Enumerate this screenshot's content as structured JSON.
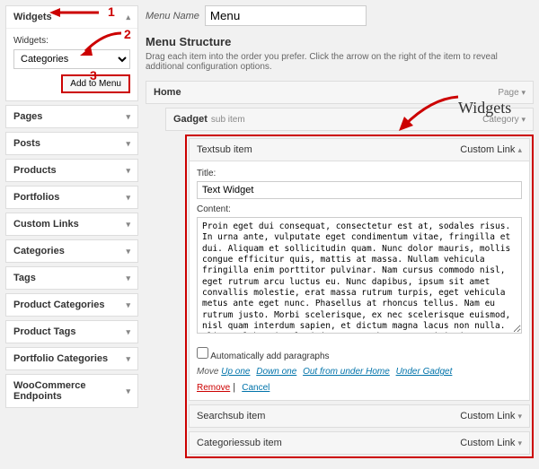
{
  "sidebar": {
    "widgets_title": "Widgets",
    "widgets_label": "Widgets:",
    "widgets_select": "Categories",
    "add_btn": "Add to Menu",
    "sections": [
      {
        "label": "Pages"
      },
      {
        "label": "Posts"
      },
      {
        "label": "Products"
      },
      {
        "label": "Portfolios"
      },
      {
        "label": "Custom Links"
      },
      {
        "label": "Categories"
      },
      {
        "label": "Tags"
      },
      {
        "label": "Product Categories"
      },
      {
        "label": "Product Tags"
      },
      {
        "label": "Portfolio Categories"
      },
      {
        "label": "WooCommerce Endpoints"
      }
    ]
  },
  "main": {
    "menu_name_label": "Menu Name",
    "menu_name_value": "Menu",
    "structure_title": "Menu Structure",
    "structure_desc": "Drag each item into the order you prefer. Click the arrow on the right of the item to reveal additional configuration options.",
    "items": {
      "home": {
        "name": "Home",
        "type": "Page"
      },
      "gadget": {
        "name": "Gadget",
        "sub": "sub item",
        "type": "Category"
      },
      "text": {
        "name": "Text",
        "sub": "sub item",
        "type": "Custom Link",
        "title_label": "Title:",
        "title_value": "Text Widget",
        "content_label": "Content:",
        "content_value": "Proin eget dui consequat, consectetur est at, sodales risus. In urna ante, vulputate eget condimentum vitae, fringilla et dui. Aliquam et sollicitudin quam. Nunc dolor mauris, mollis congue efficitur quis, mattis at massa. Nullam vehicula fringilla enim porttitor pulvinar. Nam cursus commodo nisl, eget rutrum arcu luctus eu. Nunc dapibus, ipsum sit amet convallis molestie, erat massa rutrum turpis, eget vehicula metus ante eget nunc. Phasellus at rhoncus tellus. Nam eu rutrum justo. Morbi scelerisque, ex nec scelerisque euismod, nisl quam interdum sapien, et dictum magna lacus non nulla. Aliquam lobortis ultricies ante, rhoncus suscipit justo elementum a.",
        "auto_para": "Automatically add paragraphs",
        "move_label": "Move",
        "move_links": [
          "Up one",
          "Down one",
          "Out from under Home",
          "Under Gadget"
        ],
        "remove": "Remove",
        "cancel": "Cancel"
      },
      "search": {
        "name": "Search",
        "sub": "sub item",
        "type": "Custom Link"
      },
      "categories": {
        "name": "Categories",
        "sub": "sub item",
        "type": "Custom Link"
      }
    }
  },
  "annotations": {
    "n1": "1",
    "n2": "2",
    "n3": "3",
    "widgets_label": "Widgets"
  }
}
